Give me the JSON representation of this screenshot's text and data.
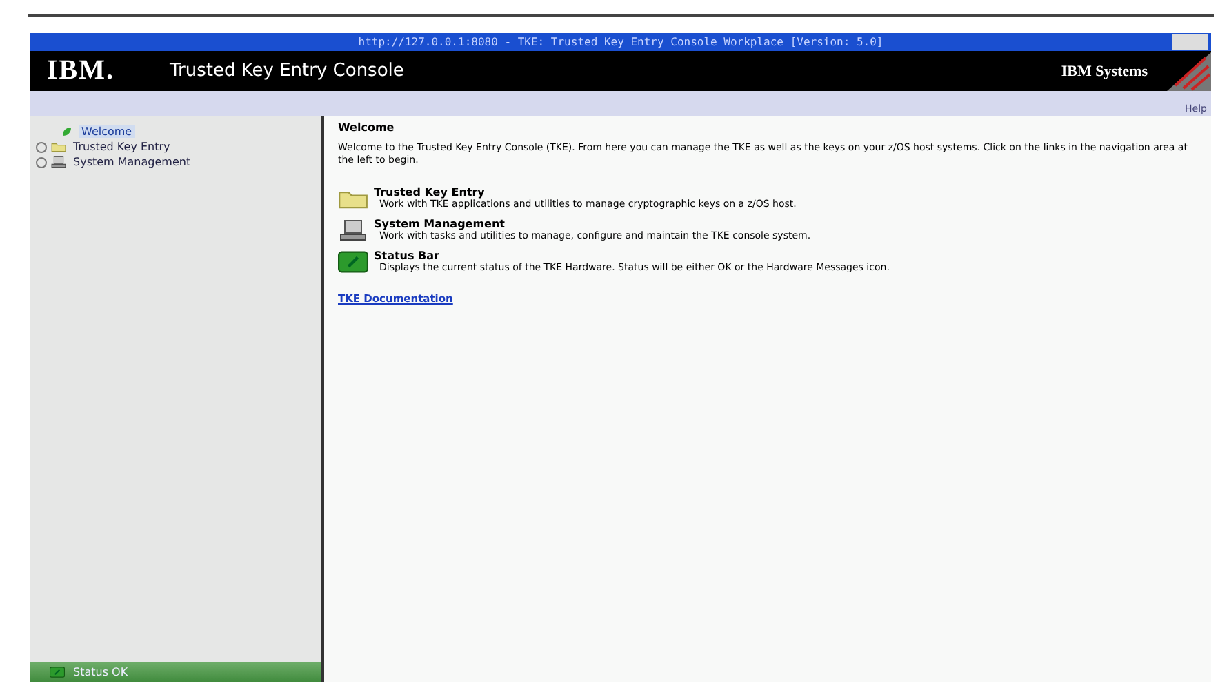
{
  "window": {
    "title": "http://127.0.0.1:8080 - TKE: Trusted Key Entry Console Workplace [Version: 5.0]"
  },
  "header": {
    "logo": "IBM.",
    "title": "Trusted Key Entry Console",
    "brand": "IBM Systems",
    "help": "Help"
  },
  "sidebar": {
    "items": [
      {
        "label": "Welcome",
        "kind": "welcome",
        "selected": true,
        "expandable": false
      },
      {
        "label": "Trusted Key Entry",
        "kind": "folder",
        "selected": false,
        "expandable": true
      },
      {
        "label": "System Management",
        "kind": "computer",
        "selected": false,
        "expandable": true
      }
    ],
    "status": "Status OK"
  },
  "content": {
    "heading": "Welcome",
    "intro": "Welcome to the Trusted Key Entry Console (TKE). From here you can manage the TKE as well as the keys on your z/OS host systems. Click on the links in the navigation area at the left to begin.",
    "sections": [
      {
        "kind": "folder",
        "title": "Trusted Key Entry",
        "description": "Work with TKE applications and utilities to manage cryptographic keys on a z/OS host."
      },
      {
        "kind": "computer",
        "title": "System Management",
        "description": "Work with tasks and utilities to manage, configure and maintain the TKE console system."
      },
      {
        "kind": "status",
        "title": "Status Bar",
        "description": "Displays the current status of the TKE Hardware. Status will be either OK or the Hardware Messages icon."
      }
    ],
    "link": "TKE Documentation"
  }
}
